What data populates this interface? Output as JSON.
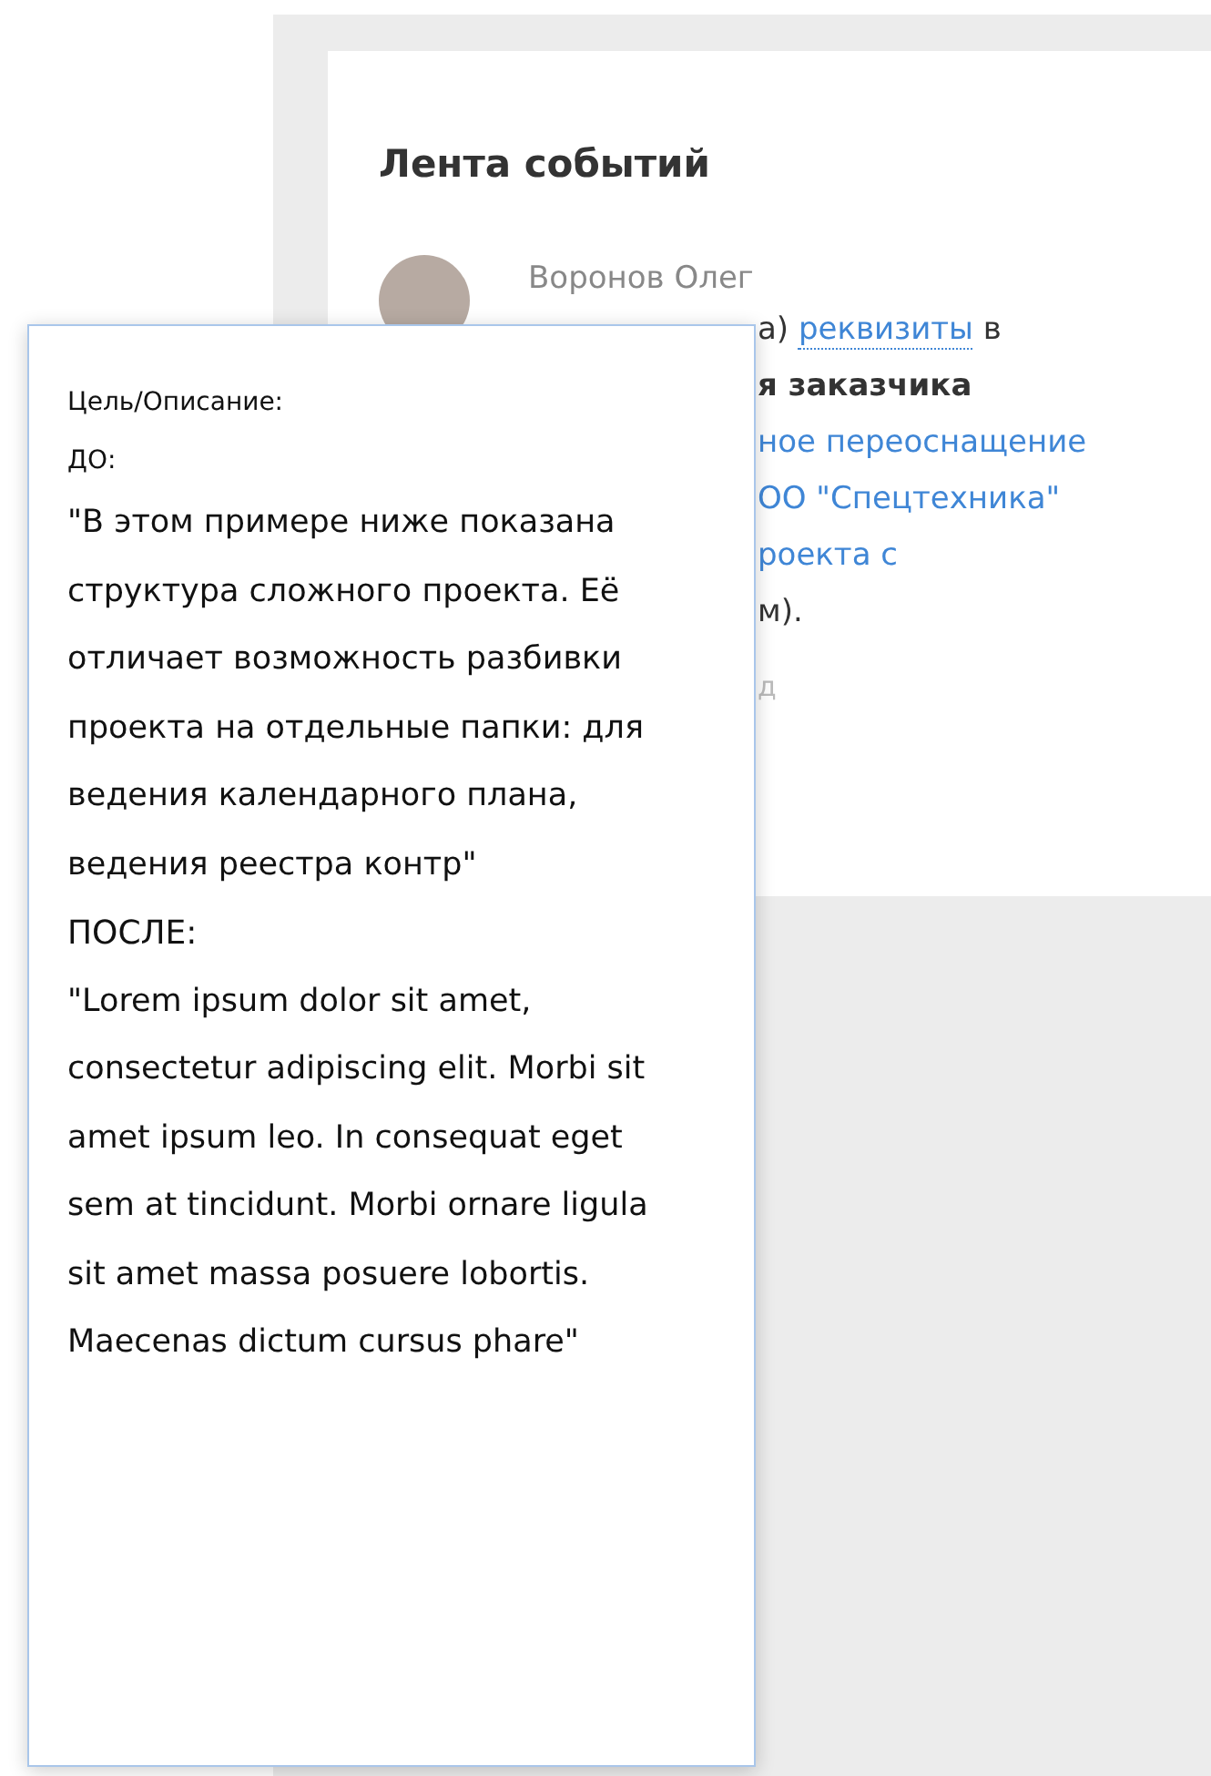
{
  "feed": {
    "title": "Лента событий",
    "events": [
      {
        "author": "Воронов Олег",
        "lines": [
          [
            {
              "text": "а) ",
              "kind": "plain"
            },
            {
              "text": "реквизиты",
              "kind": "term"
            },
            {
              "text": " в",
              "kind": "plain"
            }
          ],
          [
            {
              "text": "я заказчика",
              "kind": "bold"
            }
          ],
          [
            {
              "text": "ное переоснащение",
              "kind": "link"
            }
          ],
          [
            {
              "text": "ОО \"Спецтехника\"",
              "kind": "link"
            }
          ],
          [
            {
              "text": "роекта с",
              "kind": "link"
            }
          ],
          [
            {
              "text": "м).",
              "kind": "plain"
            }
          ]
        ],
        "time": "д"
      }
    ]
  },
  "tooltip": {
    "label": "Цель/Описание:",
    "before_label": "ДО:",
    "before_text": "\"В этом примере ниже показана структура сложного проекта. Её отличает возможность разбивки проекта на отдельные папки: для ведения календарного плана, ведения реестра контр\"",
    "after_label": "ПОСЛЕ:",
    "after_text": "\"Lorem ipsum dolor sit amet, consectetur adipiscing elit. Morbi sit amet ipsum leo. In consequat eget sem at tincidunt. Morbi ornare ligula sit amet massa posuere lobortis. Maecenas dictum cursus phare\""
  }
}
